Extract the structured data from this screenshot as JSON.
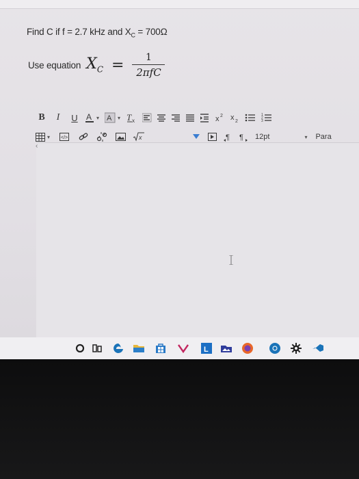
{
  "question": {
    "prefix": "Find C if f = 2.7 kHz and X",
    "sub": "C",
    "suffix": " = 700Ω"
  },
  "equation": {
    "label": "Use equation",
    "lhs_var": "X",
    "lhs_sub": "C",
    "equals": "=",
    "numerator": "1",
    "denominator": "2πfC"
  },
  "toolbar": {
    "bold": "B",
    "italic": "I",
    "underline": "U",
    "font_size": "12pt",
    "paragraph": "Para"
  },
  "colors": {
    "screen_bg": "#e4e1e6",
    "text": "#2a2a2a",
    "chrome_blue": "#1a73b8",
    "firefox_orange": "#e8672a",
    "outlook_blue": "#1c6fc4"
  },
  "taskbar_icons": [
    "cortana-icon",
    "task-view-icon",
    "edge-icon",
    "file-explorer-icon",
    "store-icon",
    "mail-icon",
    "outlook-icon",
    "photos-icon",
    "firefox-icon",
    "chrome-icon",
    "settings-icon",
    "visual-studio-icon"
  ]
}
